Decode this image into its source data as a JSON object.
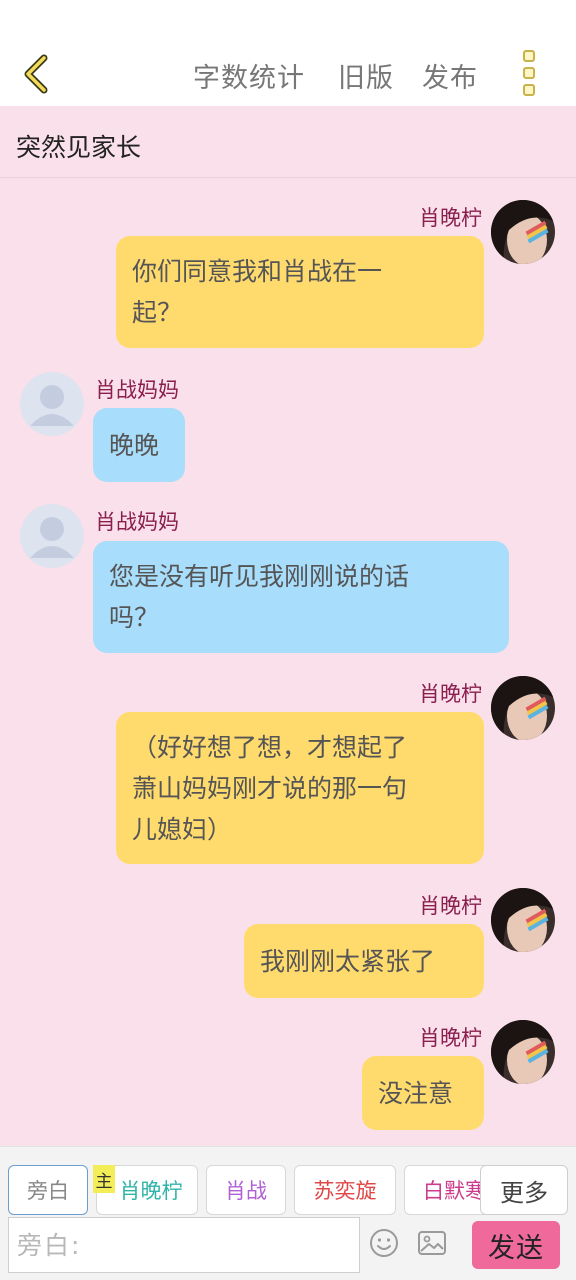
{
  "header": {
    "actions": [
      "字数统计",
      "旧版",
      "发布"
    ]
  },
  "chat": {
    "title": "突然见家长",
    "messages": [
      {
        "sender": "肖晚柠",
        "side": "right",
        "lines": [
          "你们同意我和肖战在一",
          "起？"
        ]
      },
      {
        "sender": "肖战妈妈",
        "side": "left",
        "lines": [
          "晚晚"
        ]
      },
      {
        "sender": "肖战妈妈",
        "side": "left",
        "lines": [
          "您是没有听见我刚刚说的话",
          "吗？"
        ]
      },
      {
        "sender": "肖晚柠",
        "side": "right",
        "lines": [
          "（好好想了想，才想起了",
          "萧山妈妈刚才说的那一句",
          "儿媳妇）"
        ]
      },
      {
        "sender": "肖晚柠",
        "side": "right",
        "lines": [
          "我刚刚太紧张了"
        ]
      },
      {
        "sender": "肖晚柠",
        "side": "right",
        "lines": [
          "没注意"
        ]
      }
    ]
  },
  "composer": {
    "roles": [
      {
        "label": "旁白",
        "color": "#888888"
      },
      {
        "label": "肖晚柠",
        "color": "#2fb3a8"
      },
      {
        "label": "肖战",
        "color": "#b05fd6"
      },
      {
        "label": "苏奕旋",
        "color": "#e04848"
      },
      {
        "label": "白默寒",
        "color": "#cc3b8c"
      }
    ],
    "main_tag": "主",
    "more_label": "更多",
    "input_placeholder": "旁白:",
    "send_label": "发送"
  }
}
